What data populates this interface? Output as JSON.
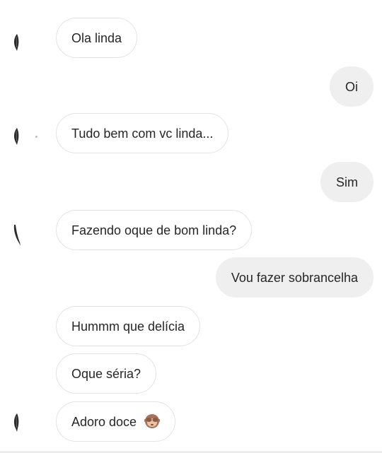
{
  "messages": [
    {
      "side": "incoming",
      "text": "Ola linda",
      "avatar": "profile-feather-icon"
    },
    {
      "side": "outgoing",
      "text": "Oi"
    },
    {
      "side": "incoming",
      "text": "Tudo bem com vc linda...",
      "avatar": "profile-feather-icon"
    },
    {
      "side": "outgoing",
      "text": "Sim"
    },
    {
      "side": "incoming",
      "text": "Fazendo oque de bom linda?",
      "avatar": "profile-feather-icon"
    },
    {
      "side": "outgoing",
      "text": "Vou fazer sobrancelha"
    },
    {
      "side": "incoming",
      "text": "Hummm que delícia"
    },
    {
      "side": "incoming",
      "text": "Oque séria?"
    },
    {
      "side": "incoming",
      "text": "Adoro doce",
      "emoji": "see-no-evil-monkey-emoji",
      "avatar": "profile-feather-icon"
    }
  ],
  "colors": {
    "incoming_bubble": "#ffffff",
    "incoming_border": "#e3e3e3",
    "outgoing_bubble": "#efefef",
    "text": "#262626"
  }
}
